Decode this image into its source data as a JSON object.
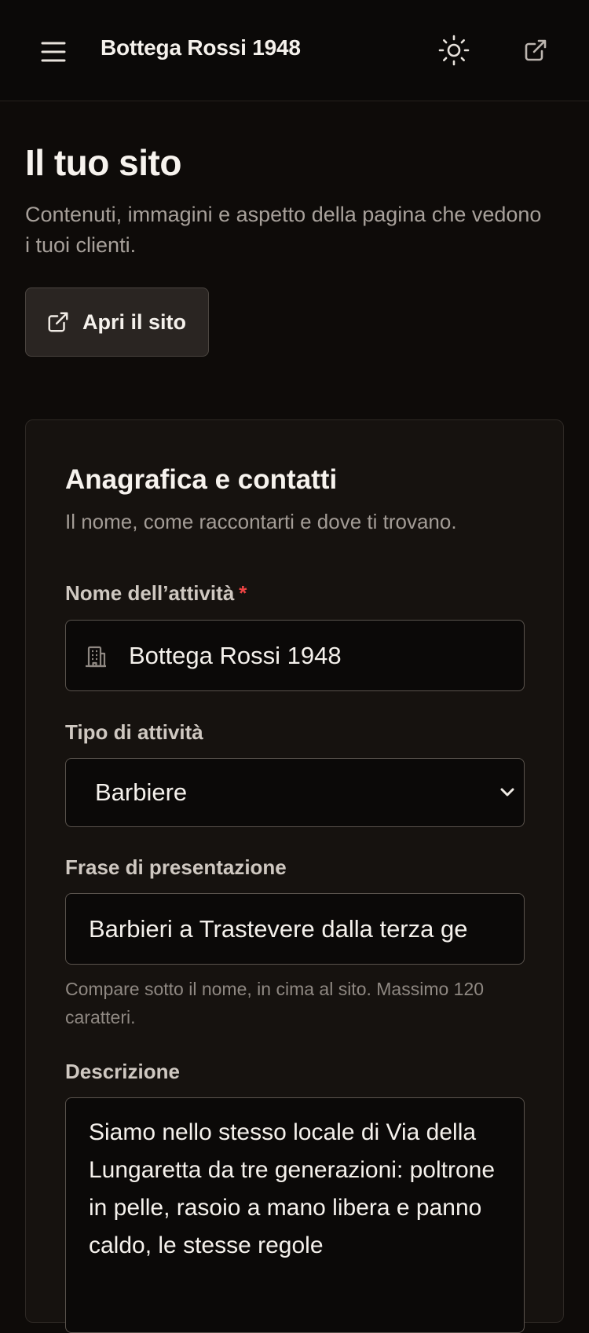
{
  "header": {
    "brand": "Bottega Rossi 1948",
    "menu_icon": "hamburger-menu-icon",
    "theme_icon": "sun-icon",
    "external_icon": "external-link-icon"
  },
  "page": {
    "title": "Il tuo sito",
    "subtitle": "Contenuti, immagini e aspetto della pagina che vedono i tuoi clienti.",
    "open_site_label": "Apri il sito"
  },
  "card": {
    "title": "Anagrafica e contatti",
    "subtitle": "Il nome, come raccontarti e dove ti trovano.",
    "fields": {
      "business_name": {
        "label": "Nome dell’attività",
        "required_mark": "*",
        "value": "Bottega Rossi 1948",
        "icon": "building-icon"
      },
      "business_type": {
        "label": "Tipo di attività",
        "value": "Barbiere"
      },
      "tagline": {
        "label": "Frase di presentazione",
        "value": "Barbieri a Trastevere dalla terza ge",
        "help": "Compare sotto il nome, in cima al sito. Massimo 120 caratteri."
      },
      "description": {
        "label": "Descrizione",
        "value": "Siamo nello stesso locale di Via della Lungaretta da tre generazioni: poltrone in pelle, rasoio a mano libera e panno caldo, le stesse regole"
      }
    }
  },
  "colors": {
    "background": "#0e0b09",
    "card": "#16120f",
    "required": "#ef4444"
  }
}
